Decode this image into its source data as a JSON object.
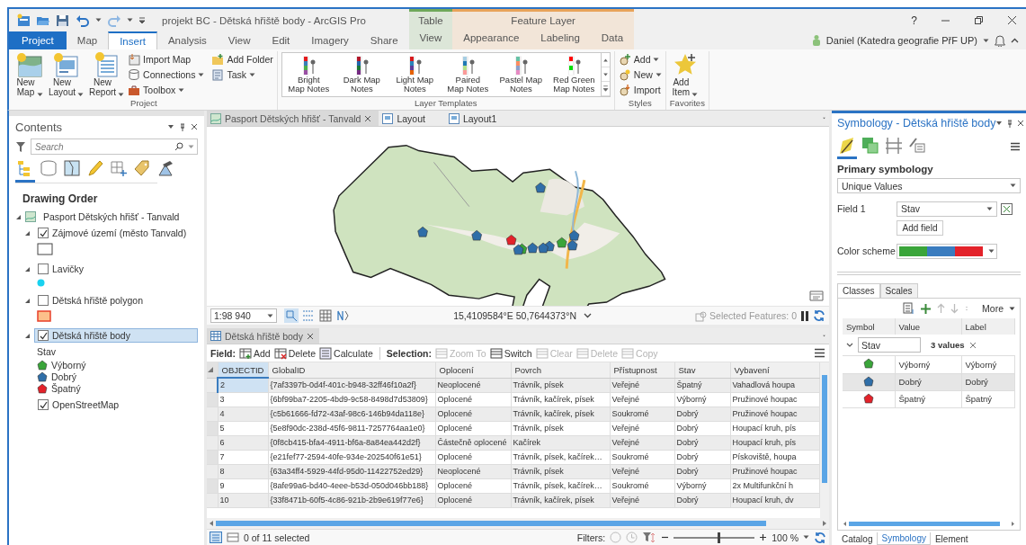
{
  "window": {
    "title": "projekt BC - Dětská hřiště body - ArcGIS Pro",
    "help": "?"
  },
  "ribbon_tabs": [
    {
      "label": "Project",
      "kind": "backstage",
      "selected": false
    },
    {
      "label": "Map",
      "kind": "tab",
      "selected": false
    },
    {
      "label": "Insert",
      "kind": "tab",
      "selected": true
    },
    {
      "label": "Analysis",
      "kind": "tab",
      "selected": false
    },
    {
      "label": "View",
      "kind": "tab",
      "selected": false
    },
    {
      "label": "Edit",
      "kind": "tab",
      "selected": false
    },
    {
      "label": "Imagery",
      "kind": "tab",
      "selected": false
    },
    {
      "label": "Share",
      "kind": "tab",
      "selected": false
    }
  ],
  "context_tabs": [
    {
      "label": "Table",
      "color": "#6fa85a",
      "tabs": [
        {
          "label": "View",
          "selected": false
        }
      ]
    },
    {
      "label": "Feature Layer",
      "color": "#e8a35a",
      "tabs": [
        {
          "label": "Appearance",
          "selected": false
        },
        {
          "label": "Labeling",
          "selected": false
        },
        {
          "label": "Data",
          "selected": false
        }
      ]
    }
  ],
  "user": {
    "name": "Daniel (Katedra geografie PřF UP)"
  },
  "ribbon_groups": [
    {
      "label": "Project",
      "kind": "buttons",
      "items": [
        {
          "kind": "large",
          "label": "New\nMap",
          "menu": true
        },
        {
          "kind": "large",
          "label": "New\nLayout",
          "menu": true
        },
        {
          "kind": "large",
          "label": "New\nReport",
          "menu": true
        },
        {
          "kind": "small",
          "label": "Import Map",
          "menu": false
        },
        {
          "kind": "small",
          "label": "Connections",
          "menu": true
        },
        {
          "kind": "small",
          "label": "Toolbox",
          "menu": true
        },
        {
          "kind": "small",
          "label": "Add Folder",
          "menu": false
        },
        {
          "kind": "small",
          "label": "Task",
          "menu": true
        }
      ]
    },
    {
      "label": "Layer Templates",
      "kind": "gallery",
      "items": [
        {
          "label": "Bright\nMap Notes"
        },
        {
          "label": "Dark Map\nNotes"
        },
        {
          "label": "Light Map\nNotes"
        },
        {
          "label": "Paired\nMap Notes"
        },
        {
          "label": "Pastel Map\nNotes"
        },
        {
          "label": "Red Green\nMap Notes"
        }
      ]
    },
    {
      "label": "Styles",
      "kind": "buttons",
      "items": [
        {
          "kind": "small",
          "label": "Add",
          "menu": true
        },
        {
          "kind": "small",
          "label": "New",
          "menu": true
        },
        {
          "kind": "small",
          "label": "Import",
          "menu": false
        }
      ]
    },
    {
      "label": "Favorites",
      "kind": "buttons",
      "items": [
        {
          "kind": "large",
          "label": "Add\nItem",
          "menu": true
        }
      ]
    }
  ],
  "contents": {
    "title": "Contents",
    "search_placeholder": "Search",
    "view_tabs": [
      {
        "selected": true
      },
      {
        "selected": false
      },
      {
        "selected": false
      },
      {
        "selected": false
      },
      {
        "selected": false
      },
      {
        "selected": false
      },
      {
        "selected": false
      }
    ],
    "heading": "Drawing Order",
    "map": {
      "label": "Pasport Dětských hřišť - Tanvald",
      "expanded": true,
      "layers": [
        {
          "label": "Zájmové území (město Tanvald)",
          "checked": true,
          "expanded": true,
          "selected": false,
          "kind": "polygon_outline"
        },
        {
          "label": "Lavičky",
          "checked": false,
          "expanded": true,
          "selected": false,
          "kind": "point"
        },
        {
          "label": "Dětská hřiště polygon",
          "checked": false,
          "expanded": true,
          "selected": false,
          "kind": "polygon_fill"
        },
        {
          "label": "Dětská hřiště body",
          "checked": true,
          "expanded": true,
          "selected": true,
          "kind": "unique_values",
          "field": "Stav",
          "classes": [
            {
              "label": "Výborný",
              "color": "#3aa53a"
            },
            {
              "label": "Dobrý",
              "color": "#2f6ea8"
            },
            {
              "label": "Špatný",
              "color": "#e3222a"
            }
          ]
        }
      ],
      "basemaps": [
        {
          "label": "OpenStreetMap",
          "checked": true
        }
      ]
    }
  },
  "doc_tabs": [
    {
      "label": "Pasport Dětských hřišť - Tanvald",
      "kind": "map",
      "selected": true
    },
    {
      "label": "Layout",
      "kind": "layout",
      "selected": false
    },
    {
      "label": "Layout1",
      "kind": "layout",
      "selected": false
    }
  ],
  "map_status": {
    "scale": "1:98 940",
    "coordinates": "15,4109584°E 50,7644373°N",
    "selected_features": "Selected Features: 0"
  },
  "table": {
    "tab": "Dětská hřiště body",
    "field_label": "Field:",
    "field_tools": [
      {
        "label": "Add",
        "disabled": false
      },
      {
        "label": "Delete",
        "disabled": false
      },
      {
        "label": "Calculate",
        "disabled": false
      }
    ],
    "selection_label": "Selection:",
    "selection_tools": [
      {
        "label": "Zoom To",
        "disabled": true
      },
      {
        "label": "Switch",
        "disabled": false
      },
      {
        "label": "Clear",
        "disabled": true
      },
      {
        "label": "Delete",
        "disabled": true
      },
      {
        "label": "Copy",
        "disabled": true
      }
    ],
    "columns": [
      {
        "label": "OBJECTID",
        "selected": true
      },
      {
        "label": "GlobalID",
        "selected": false
      },
      {
        "label": "Oplocení",
        "selected": false
      },
      {
        "label": "Povrch",
        "selected": false
      },
      {
        "label": "Přístupnost",
        "selected": false
      },
      {
        "label": "Stav",
        "selected": false
      },
      {
        "label": "Vybavení",
        "selected": false
      }
    ],
    "rows": [
      {
        "selected": true,
        "cells": [
          "2",
          "{7af3397b-0d4f-401c-b948-32ff46f10a2f}",
          "Neoplocené",
          "Trávník, písek",
          "Veřejné",
          "Špatný",
          "Vahadlová houpa"
        ]
      },
      {
        "selected": false,
        "cells": [
          "3",
          "{6bf99ba7-2205-4bd9-9c58-8498d7d53809}",
          "Oplocené",
          "Trávník, kačírek, písek",
          "Veřejné",
          "Výborný",
          "Pružinové houpac"
        ]
      },
      {
        "selected": false,
        "cells": [
          "4",
          "{c5b61666-fd72-43af-98c6-146b94da118e}",
          "Oplocené",
          "Trávník, kačírek, písek",
          "Soukromé",
          "Dobrý",
          "Pružinové houpac"
        ]
      },
      {
        "selected": false,
        "cells": [
          "5",
          "{5e8f90dc-238d-45f6-9811-7257764aa1e0}",
          "Oplocené",
          "Trávník, písek",
          "Veřejné",
          "Dobrý",
          "Houpací kruh, pís"
        ]
      },
      {
        "selected": false,
        "cells": [
          "6",
          "{0f8cb415-bfa4-4911-bf6a-8a84ea442d2f}",
          "Částečně oplocené",
          "Kačírek",
          "Veřejné",
          "Dobrý",
          "Houpací kruh, pís"
        ]
      },
      {
        "selected": false,
        "cells": [
          "7",
          "{e21fef77-2594-40fe-934e-202540f61e51}",
          "Oplocené",
          "Trávník, písek, kačírek…",
          "Soukromé",
          "Dobrý",
          "Pískoviště, houpa"
        ]
      },
      {
        "selected": false,
        "cells": [
          "8",
          "{63a34ff4-5929-44fd-95d0-11422752ed29}",
          "Neoplocené",
          "Trávník, písek",
          "Veřejné",
          "Dobrý",
          "Pružinové houpac"
        ]
      },
      {
        "selected": false,
        "cells": [
          "9",
          "{8afe99a6-bd40-4eee-b53d-050d046bb188}",
          "Oplocené",
          "Trávník, písek, kačírek…",
          "Soukromé",
          "Výborný",
          "2x Multifunkční h"
        ]
      },
      {
        "selected": false,
        "cells": [
          "10",
          "{33f8471b-60f5-4c86-921b-2b9e619f77e6}",
          "Oplocené",
          "Trávník, kačírek, písek",
          "Veřejné",
          "Dobrý",
          "Houpací kruh, dv"
        ]
      }
    ],
    "status": "0 of 11 selected",
    "filters_label": "Filters:",
    "zoom": {
      "level": 0.55,
      "reading": "100 %"
    }
  },
  "symbology": {
    "title": "Symbology - Dětská hřiště body",
    "view_tabs": [
      {
        "selected": true
      },
      {
        "selected": false
      },
      {
        "selected": false
      },
      {
        "selected": false
      }
    ],
    "heading": "Primary symbology",
    "method": "Unique Values",
    "field_label": "Field 1",
    "field_value": "Stav",
    "add_field": "Add field",
    "color_scheme_label": "Color scheme",
    "color_scheme": [
      {
        "color": "#3aa53a"
      },
      {
        "color": "#3a7cbf"
      },
      {
        "color": "#e3222a"
      }
    ],
    "class_tabs": [
      {
        "label": "Classes",
        "selected": true
      },
      {
        "label": "Scales",
        "selected": false
      }
    ],
    "more": "More",
    "columns": [
      "Symbol",
      "Value",
      "Label"
    ],
    "group": {
      "field": "Stav",
      "count": "3 values",
      "expanded": true
    },
    "classes": [
      {
        "value": "Výborný",
        "label": "Výborný",
        "color": "#3aa53a",
        "selected": false
      },
      {
        "value": "Dobrý",
        "label": "Dobrý",
        "color": "#2f6ea8",
        "selected": true
      },
      {
        "value": "Špatný",
        "label": "Špatný",
        "color": "#e3222a",
        "selected": false
      }
    ]
  },
  "pane_tabs": [
    {
      "label": "Catalog",
      "selected": false
    },
    {
      "label": "Symbology",
      "selected": true
    },
    {
      "label": "Element",
      "selected": false
    }
  ]
}
